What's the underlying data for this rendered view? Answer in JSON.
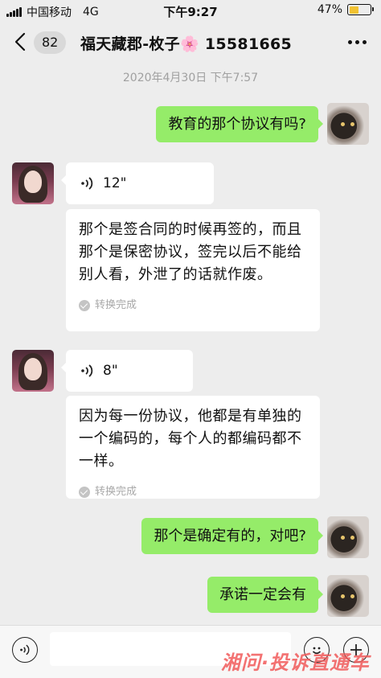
{
  "status_bar": {
    "carrier": "中国移动",
    "network": "4G",
    "time": "下午9:27",
    "battery_percent": "47%",
    "battery_level": 0.47
  },
  "header": {
    "back_icon": "chevron-left-icon",
    "unread_count": "82",
    "title": "福天藏郡-枚子🌸 15581665",
    "more_icon": "more-dots-icon"
  },
  "chat": {
    "timestamp": "2020年4月30日 下午7:57",
    "messages": [
      {
        "side": "sent",
        "text": "教育的那个协议有吗?"
      },
      {
        "side": "recv",
        "type": "voice",
        "duration": "12\"",
        "transcript": "那个是签合同的时候再签的，而且那个是保密协议，签完以后不能给别人看，外泄了的话就作废。",
        "status": "转换完成"
      },
      {
        "side": "recv",
        "type": "voice",
        "duration": "8\"",
        "transcript": "因为每一份协议，他都是有单独的一个编码的，每个人的都编码都不一样。",
        "status": "转换完成"
      },
      {
        "side": "sent",
        "text": "那个是确定有的，对吧?"
      },
      {
        "side": "sent",
        "text": "承诺一定会有"
      }
    ]
  },
  "input_bar": {
    "voice_icon": "voice-toggle-icon",
    "emoji_icon": "emoji-icon",
    "plus_icon": "plus-icon",
    "watermark": "湘问·投诉直通车"
  },
  "colors": {
    "sent_bubble": "#95ec69",
    "received_bubble": "#ffffff",
    "background": "#ededed",
    "battery_fill": "#f2c232"
  }
}
